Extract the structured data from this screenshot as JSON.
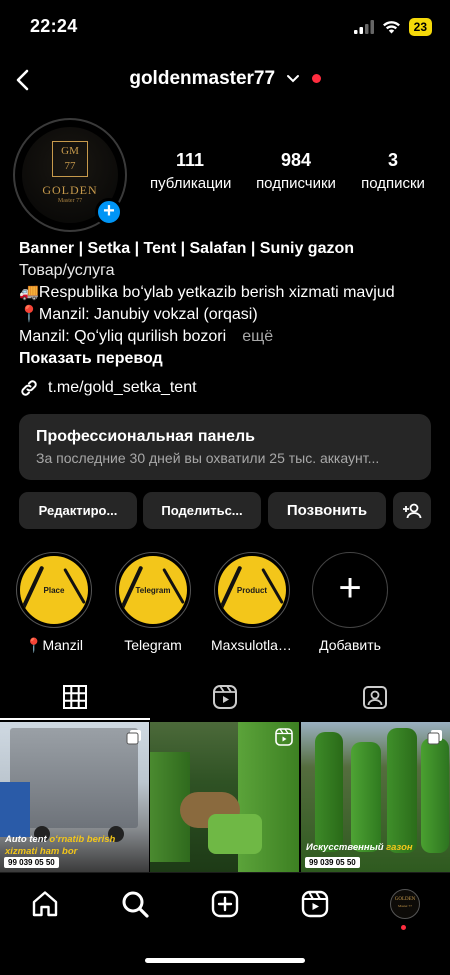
{
  "status_bar": {
    "time": "22:24",
    "battery": "23"
  },
  "header": {
    "username": "goldenmaster77"
  },
  "avatar": {
    "logo_line1": "GM",
    "logo_line2": "77",
    "logo_name": "GOLDEN",
    "logo_sub": "Master 77"
  },
  "stats": [
    {
      "value": "111",
      "label": "публикации"
    },
    {
      "value": "984",
      "label": "подписчики"
    },
    {
      "value": "3",
      "label": "подписки"
    }
  ],
  "bio": {
    "name": "Banner | Setka | Tent | Salafan | Suniy gazon",
    "category": "Товар/услуга",
    "line1": "🚚Respublika boʻylab yetkazib berish xizmati mavjud",
    "line2": "📍Manzil: Janubiy vokzal (orqasi)",
    "line3": "Manzil: Qoʻyliq qurilish bozori",
    "more": "ещё",
    "translate": "Показать перевод",
    "link": "t.me/gold_setka_tent"
  },
  "pro_panel": {
    "title": "Профессиональная панель",
    "subtitle": "За последние 30 дней вы охватили 25 тыс. аккаунт..."
  },
  "buttons": {
    "edit": "Редактиро...",
    "share": "Поделитьс...",
    "call": "Позвонить"
  },
  "highlights": [
    {
      "tag": "Place",
      "caption": "📍Manzil"
    },
    {
      "tag": "Telegram",
      "caption": "Telegram"
    },
    {
      "tag": "Product",
      "caption": "Maxsulotlari..."
    },
    {
      "caption": "Добавить"
    }
  ],
  "posts": [
    {
      "caption_a": "Auto tent ",
      "caption_b": "oʻrnatib berish",
      "caption_c": "xizmati ham bor",
      "phone": "99 039 05 50"
    },
    {
      "caption_a": "",
      "caption_b": "",
      "caption_c": "",
      "phone": ""
    },
    {
      "caption_a": "Искусственный ",
      "caption_b": "газон",
      "caption_c": "",
      "phone": "99 039 05 50"
    }
  ],
  "nav_profile": {
    "logo_line1": "GOLDEN",
    "logo_line2": "Master 77"
  },
  "colors": {
    "accent": "#0095f6",
    "gold": "#c79a4c",
    "highlight_yellow": "#f3c61a",
    "live_dot": "#ff2d3f"
  }
}
